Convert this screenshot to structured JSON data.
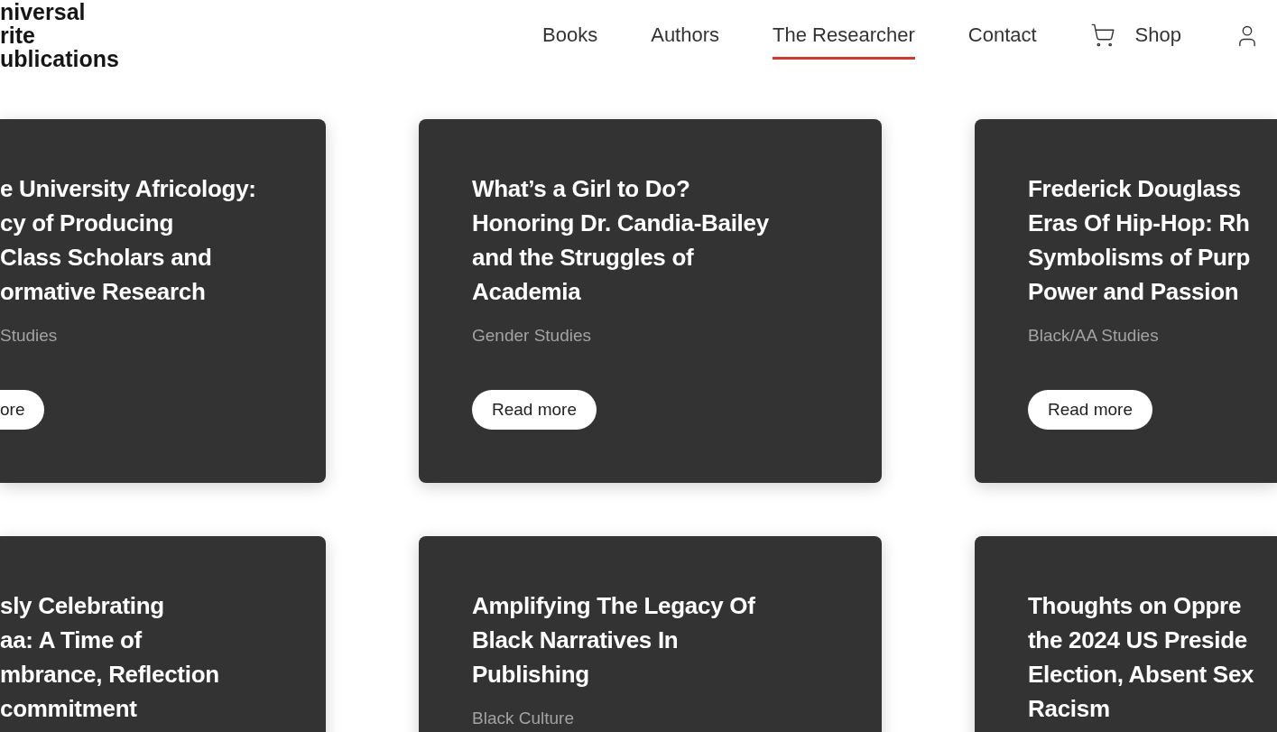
{
  "header": {
    "logo_lines": [
      "niversal",
      "rite",
      "ublications"
    ],
    "nav": [
      {
        "label": "Books",
        "kind": "link",
        "selected": false
      },
      {
        "label": "Authors",
        "kind": "link",
        "selected": false
      },
      {
        "label": "The Researcher",
        "kind": "link",
        "selected": true
      },
      {
        "label": "Contact",
        "kind": "link",
        "selected": false
      },
      {
        "label": "Shop",
        "kind": "shop",
        "selected": false
      }
    ]
  },
  "card_rows": [
    [
      {
        "title_lines": [
          "e University Africology:",
          "cy of Producing",
          "Class Scholars and",
          "ormative Research"
        ],
        "category": "Studies",
        "button": "ore"
      },
      {
        "title_lines": [
          "What’s a Girl to Do?",
          "Honoring Dr. Candia-Bailey",
          "and the Struggles of",
          "Academia"
        ],
        "category": "Gender Studies",
        "button": "Read more"
      },
      {
        "title_lines": [
          "Frederick Douglass",
          "Eras Of Hip-Hop: Rh",
          "Symbolisms of Purp",
          "Power and Passion"
        ],
        "category": "Black/AA Studies",
        "button": "Read more"
      }
    ],
    [
      {
        "title_lines": [
          "sly Celebrating",
          "aa: A Time of",
          "mbrance, Reflection",
          "commitment"
        ]
      },
      {
        "title_lines": [
          "Amplifying The Legacy Of",
          "Black Narratives In",
          "Publishing"
        ],
        "category": "Black Culture"
      },
      {
        "title_lines": [
          "Thoughts on Oppre",
          "the 2024 US Preside",
          "Election, Absent Sex",
          "Racism"
        ]
      }
    ]
  ]
}
